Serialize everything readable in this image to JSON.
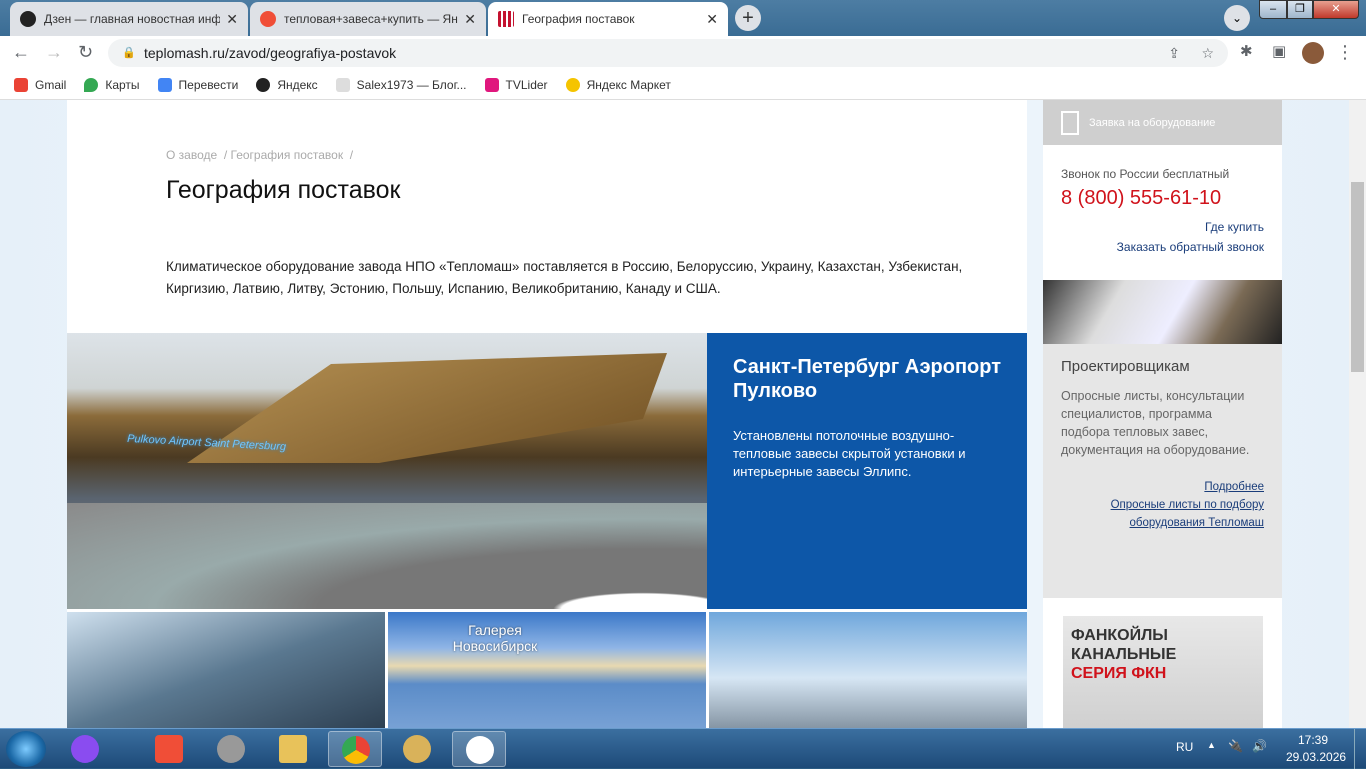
{
  "browser": {
    "tabs": [
      {
        "title": "Дзен — главная новостная инф",
        "icon": "dzen-icon",
        "color": "#222222"
      },
      {
        "title": "тепловая+завеса+купить — Ян",
        "icon": "yandex-icon",
        "color": "#f04e37"
      },
      {
        "title": "География поставок",
        "icon": "teplomash-icon",
        "color": "#c4122f",
        "active": true
      }
    ],
    "url": "teplomash.ru/zavod/geografiya-postavok",
    "bookmarks": [
      {
        "label": "Gmail",
        "color": "#ea4335"
      },
      {
        "label": "Карты",
        "color": "#34a853"
      },
      {
        "label": "Перевести",
        "color": "#4285f4"
      },
      {
        "label": "Яндекс",
        "color": "#222222"
      },
      {
        "label": "Salex1973 — Блог...",
        "color": "#999999"
      },
      {
        "label": "TVLider",
        "color": "#e0177d"
      },
      {
        "label": "Яндекс Маркет",
        "color": "#f5c400"
      }
    ]
  },
  "page": {
    "breadcrumb": [
      "О заводе",
      "География поставок"
    ],
    "title": "География поставок",
    "intro": "Климатическое оборудование завода НПО «Тепломаш» поставляется в Россию, Белоруссию, Украину, Казахстан, Узбекистан, Киргизию, Латвию, Литву, Эстонию, Польшу, Испанию, Великобританию, Канаду и США.",
    "featured": {
      "title": "Санкт-Петербург Аэропорт Пулково",
      "text": "Установлены потолочные воздушно-тепловые завесы скрытой установки и интерьерные завесы Эллипс.",
      "photo_sign": "Pulkovo Airport Saint Petersburg"
    },
    "thumb_signs": [
      "Галерея Новосибирск"
    ]
  },
  "sidebar": {
    "request": "Заявка на оборудование",
    "call_label": "Звонок по России бесплатный",
    "phone": "8 (800) 555-61-10",
    "where_buy": "Где купить",
    "callback": "Заказать обратный звонок",
    "designers_title": "Проектировщикам",
    "designers_text": "Опросные листы, консультации специалистов, программа подбора тепловых завес, документация на оборудование.",
    "more": "Подробнее",
    "forms_link_1": "Опросные листы по подбору",
    "forms_link_2": "оборудования Тепломаш",
    "ad_line1": "ФАНКОЙЛЫ КАНАЛЬНЫЕ",
    "ad_line2": "СЕРИЯ ФКН"
  },
  "taskbar": {
    "lang": "RU",
    "time": "17:39",
    "date": "29.03.2026"
  }
}
